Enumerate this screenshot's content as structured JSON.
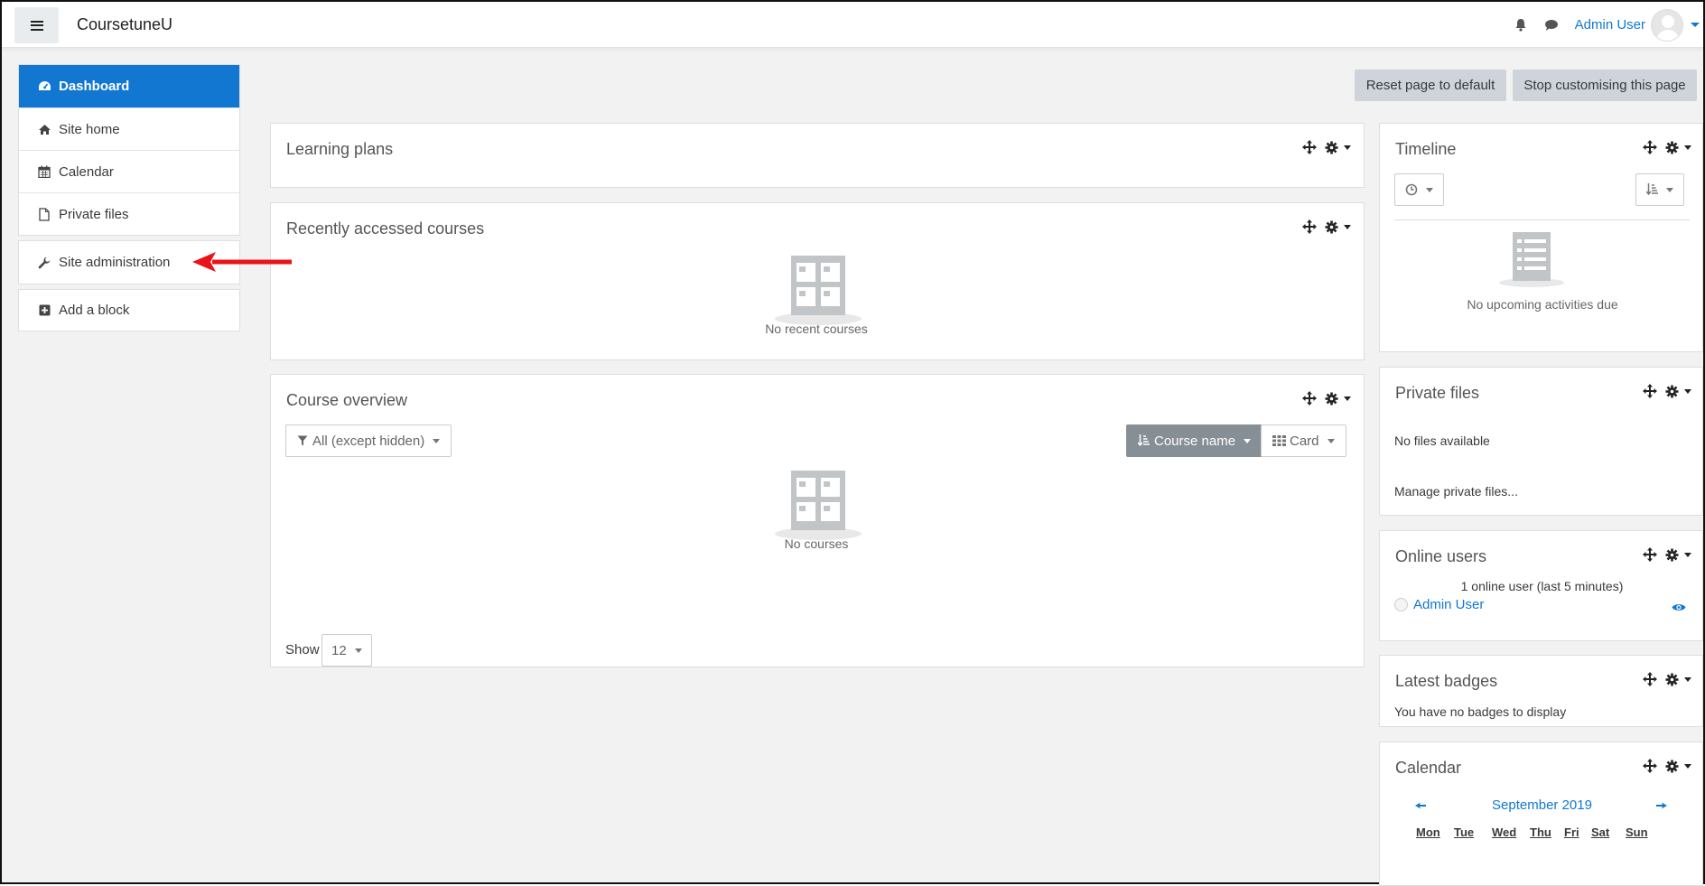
{
  "navbar": {
    "site_name": "CoursetuneU",
    "user_name": "Admin User"
  },
  "drawer": {
    "items": [
      {
        "label": "Dashboard",
        "icon": "tachometer-icon",
        "active": true
      },
      {
        "label": "Site home",
        "icon": "home-icon"
      },
      {
        "label": "Calendar",
        "icon": "calendar-icon"
      },
      {
        "label": "Private files",
        "icon": "file-icon"
      }
    ],
    "site_admin": {
      "label": "Site administration",
      "icon": "wrench-icon"
    },
    "add_block": {
      "label": "Add a block",
      "icon": "plus-square-icon"
    }
  },
  "page_buttons": {
    "reset": "Reset page to default",
    "stop": "Stop customising this page"
  },
  "learning_plans": {
    "title": "Learning plans"
  },
  "recent_courses": {
    "title": "Recently accessed courses",
    "empty": "No recent courses"
  },
  "course_overview": {
    "title": "Course overview",
    "filter": "All (except hidden)",
    "sort": "Course name",
    "view": "Card",
    "empty": "No courses",
    "show_label": "Show",
    "show_value": "12"
  },
  "timeline": {
    "title": "Timeline",
    "empty": "No upcoming activities due"
  },
  "private_files": {
    "title": "Private files",
    "empty": "No files available",
    "manage": "Manage private files..."
  },
  "online_users": {
    "title": "Online users",
    "summary": "1 online user (last 5 minutes)",
    "user": "Admin User"
  },
  "latest_badges": {
    "title": "Latest badges",
    "empty": "You have no badges to display"
  },
  "calendar": {
    "title": "Calendar",
    "month": "September 2019",
    "days": [
      "Mon",
      "Tue",
      "Wed",
      "Thu",
      "Fri",
      "Sat",
      "Sun"
    ]
  },
  "colors": {
    "accent": "#1177d1",
    "annotation": "#e8141a",
    "drawer_bg": "#f2f2f2"
  }
}
